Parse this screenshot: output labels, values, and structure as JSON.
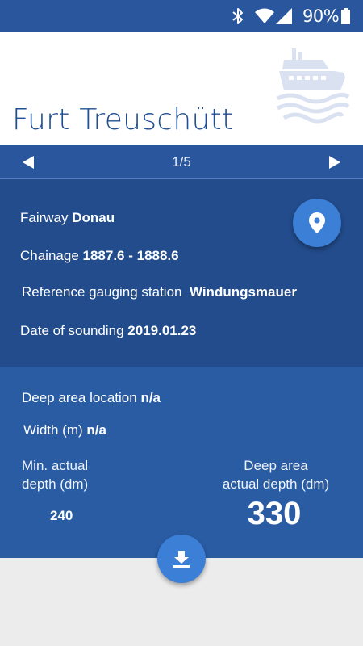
{
  "status_bar": {
    "battery_percent": "90%",
    "icons": [
      "bluetooth-icon",
      "wifi-icon",
      "signal-icon",
      "battery-icon"
    ]
  },
  "header": {
    "title": "Furt Treuschütt",
    "logo_icon": "ship-icon"
  },
  "pager": {
    "page": "1/5",
    "prev_icon": "triangle-left-icon",
    "next_icon": "triangle-right-icon"
  },
  "info": {
    "fairway_label": "Fairway",
    "fairway_value": "Donau",
    "chainage_label": "Chainage",
    "chainage_value": "1887.6 - 1888.6",
    "gauging_label": "Reference gauging station",
    "gauging_value": "Windungsmauer",
    "date_label": "Date of sounding",
    "date_value": "2019.01.23",
    "map_icon": "location-pin-icon"
  },
  "deep_area": {
    "location_label": "Deep area location",
    "location_value": "n/a",
    "width_label": "Width (m)",
    "width_value": "n/a",
    "min_depth_label_line1": "Min. actual",
    "min_depth_label_line2": "depth (dm)",
    "min_depth_value": "240",
    "deep_depth_label_line1": "Deep area",
    "deep_depth_label_line2": "actual depth (dm)",
    "deep_depth_value": "330",
    "download_icon": "download-icon"
  },
  "colors": {
    "primary": "#2a569e",
    "info_bg": "#234c8c",
    "deep_bg": "#2a5ca4",
    "accent_button": "#3b7fd6",
    "title_text": "#1f4f93",
    "page_bg": "#ececec"
  }
}
